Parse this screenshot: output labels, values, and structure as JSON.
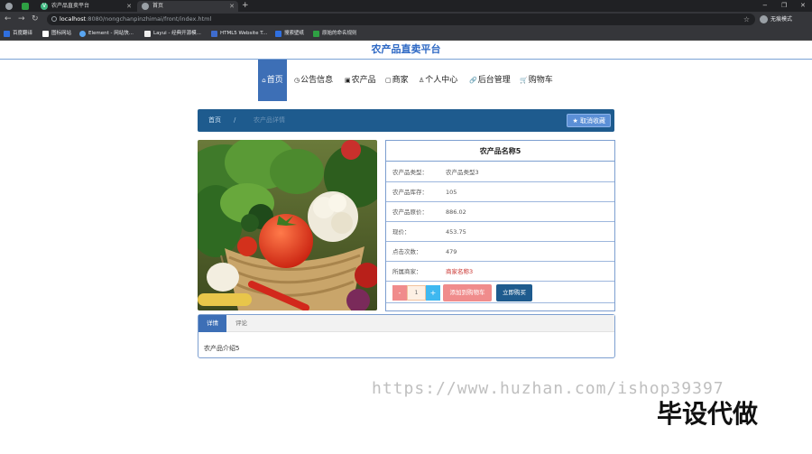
{
  "browser": {
    "tabs": [
      {
        "label": ""
      },
      {
        "label": ""
      },
      {
        "label": "农产品直卖平台"
      },
      {
        "label": "首页"
      }
    ],
    "new_tab": "+",
    "window_controls": [
      "−",
      "❐",
      "✕"
    ],
    "url_host": "localhost",
    "url_path": ":8080/nongchanpinzhimai/front/index.html",
    "profile_label": "无痕模式",
    "bookmarks": [
      {
        "label": "百度翻译",
        "color": "#2f6fe0"
      },
      {
        "label": "图标网站",
        "color": "#ffffff"
      },
      {
        "label": "Element - 网站快...",
        "color": "#59a6f2"
      },
      {
        "label": "Layui - 经典开源模...",
        "color": "#eeeeee"
      },
      {
        "label": "HTML5 Website T...",
        "color": "#3e6ccf"
      },
      {
        "label": "搜索壁纸",
        "color": "#2f6fe0"
      },
      {
        "label": "原始的命名规则",
        "color": "#2ea043"
      }
    ]
  },
  "site": {
    "title": "农产品直卖平台",
    "nav": [
      {
        "icon": "⌂",
        "label": "首页"
      },
      {
        "icon": "◷",
        "label": "公告信息"
      },
      {
        "icon": "▣",
        "label": "农产品"
      },
      {
        "icon": "▢",
        "label": "商家"
      },
      {
        "icon": "♙",
        "label": "个人中心"
      },
      {
        "icon": "🔗",
        "label": "后台管理"
      },
      {
        "icon": "🛒",
        "label": "购物车"
      }
    ]
  },
  "breadcrumb": {
    "home": "首页",
    "sep": "/",
    "current": "农产品详情",
    "favorite_icon": "★",
    "favorite_label": "取消收藏"
  },
  "product": {
    "badge": "",
    "name": "农产品名称5",
    "fields": [
      {
        "key": "农产品类型：",
        "value": "农产品类型3"
      },
      {
        "key": "农产品库存：",
        "value": "105"
      },
      {
        "key": "农产品原价：",
        "value": "886.02"
      },
      {
        "key": "现价：",
        "value": "453.75"
      },
      {
        "key": "点击次数：",
        "value": "479"
      },
      {
        "key": "所属商家：",
        "value": "商家名称3"
      }
    ],
    "quantity": "1",
    "minus": "-",
    "plus": "+",
    "add_to_cart": "添加到购物车",
    "buy_now": "立即购买"
  },
  "detail": {
    "tabs": [
      "详情",
      "评论"
    ],
    "content": "农产品介绍5"
  },
  "watermark": {
    "url": "https://www.huzhan.com/ishop39397",
    "label": "毕设代做"
  }
}
